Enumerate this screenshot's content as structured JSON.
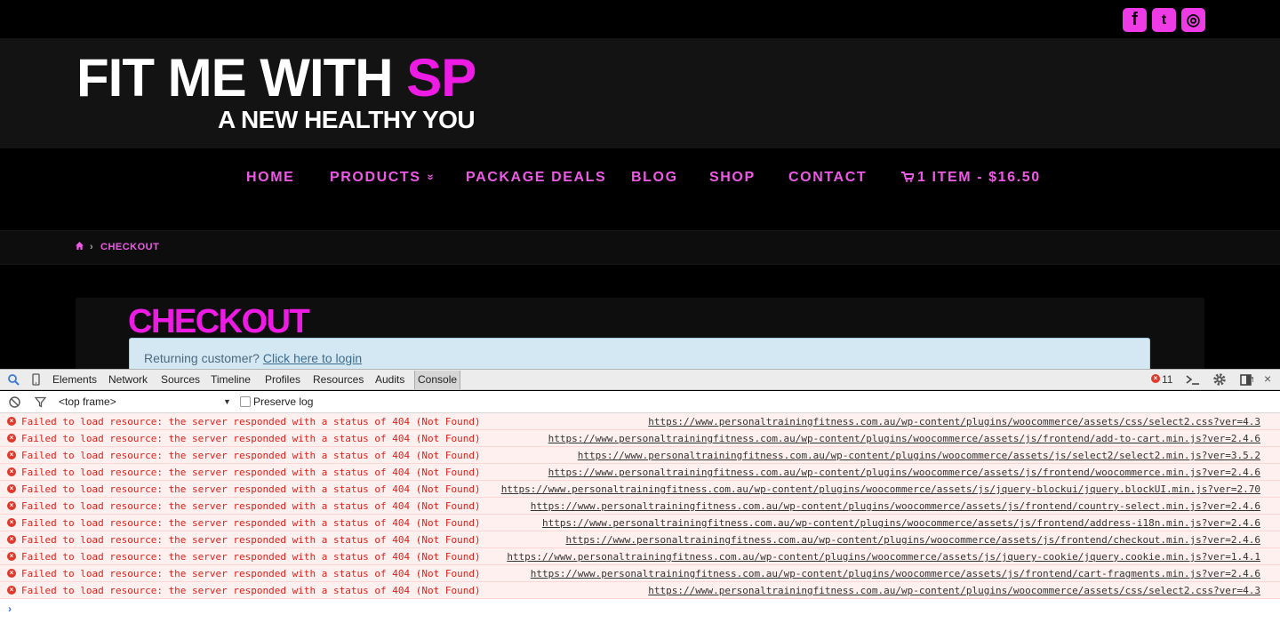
{
  "site": {
    "logo_main": "FIT ME WITH ",
    "logo_accent": "SP",
    "tagline": "A NEW HEALTHY YOU",
    "social": [
      {
        "icon": "facebook-icon",
        "glyph": "f"
      },
      {
        "icon": "twitter-icon",
        "glyph": "t"
      },
      {
        "icon": "instagram-icon",
        "glyph": "◎"
      }
    ]
  },
  "nav": {
    "home": "HOME",
    "products": "PRODUCTS",
    "products_chevron": "»",
    "package_deals": "PACKAGE DEALS",
    "blog": "BLOG",
    "shop": "SHOP",
    "contact": "CONTACT",
    "cart": "1 ITEM - $16.50"
  },
  "breadcrumb": {
    "home_icon": "home-icon",
    "separator": "›",
    "current": "CHECKOUT"
  },
  "page": {
    "title": "CHECKOUT",
    "notice_text": "Returning customer?",
    "notice_link": "Click here to login"
  },
  "devtools": {
    "tabs": [
      "Elements",
      "Network",
      "Sources",
      "Timeline",
      "Profiles",
      "Resources",
      "Audits",
      "Console"
    ],
    "active_tab": "Console",
    "error_count": "11",
    "frame": "<top frame>",
    "preserve_log": "Preserve log",
    "colors": {
      "error": "#e0201a",
      "error_bg": "#fff0f0",
      "accent": "#ee1be4"
    },
    "errors": [
      {
        "msg": "Failed to load resource: the server responded with a status of 404 (Not Found)",
        "src": "https://www.personaltrainingfitness.com.au/wp-content/plugins/woocommerce/assets/css/select2.css?ver=4.3"
      },
      {
        "msg": "Failed to load resource: the server responded with a status of 404 (Not Found)",
        "src": "https://www.personaltrainingfitness.com.au/wp-content/plugins/woocommerce/assets/js/frontend/add-to-cart.min.js?ver=2.4.6"
      },
      {
        "msg": "Failed to load resource: the server responded with a status of 404 (Not Found)",
        "src": "https://www.personaltrainingfitness.com.au/wp-content/plugins/woocommerce/assets/js/select2/select2.min.js?ver=3.5.2"
      },
      {
        "msg": "Failed to load resource: the server responded with a status of 404 (Not Found)",
        "src": "https://www.personaltrainingfitness.com.au/wp-content/plugins/woocommerce/assets/js/frontend/woocommerce.min.js?ver=2.4.6"
      },
      {
        "msg": "Failed to load resource: the server responded with a status of 404 (Not Found)",
        "src": "https://www.personaltrainingfitness.com.au/wp-content/plugins/woocommerce/assets/js/jquery-blockui/jquery.blockUI.min.js?ver=2.70"
      },
      {
        "msg": "Failed to load resource: the server responded with a status of 404 (Not Found)",
        "src": "https://www.personaltrainingfitness.com.au/wp-content/plugins/woocommerce/assets/js/frontend/country-select.min.js?ver=2.4.6"
      },
      {
        "msg": "Failed to load resource: the server responded with a status of 404 (Not Found)",
        "src": "https://www.personaltrainingfitness.com.au/wp-content/plugins/woocommerce/assets/js/frontend/address-i18n.min.js?ver=2.4.6"
      },
      {
        "msg": "Failed to load resource: the server responded with a status of 404 (Not Found)",
        "src": "https://www.personaltrainingfitness.com.au/wp-content/plugins/woocommerce/assets/js/frontend/checkout.min.js?ver=2.4.6"
      },
      {
        "msg": "Failed to load resource: the server responded with a status of 404 (Not Found)",
        "src": "https://www.personaltrainingfitness.com.au/wp-content/plugins/woocommerce/assets/js/jquery-cookie/jquery.cookie.min.js?ver=1.4.1"
      },
      {
        "msg": "Failed to load resource: the server responded with a status of 404 (Not Found)",
        "src": "https://www.personaltrainingfitness.com.au/wp-content/plugins/woocommerce/assets/js/frontend/cart-fragments.min.js?ver=2.4.6"
      },
      {
        "msg": "Failed to load resource: the server responded with a status of 404 (Not Found)",
        "src": "https://www.personaltrainingfitness.com.au/wp-content/plugins/woocommerce/assets/css/select2.css?ver=4.3"
      }
    ]
  }
}
